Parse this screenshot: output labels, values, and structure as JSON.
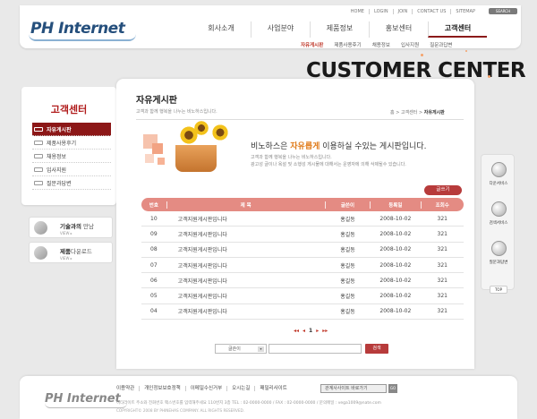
{
  "header": {
    "logo": "PH Internet",
    "util_links": [
      "HOME",
      "LOGIN",
      "JOIN",
      "CONTACT US",
      "SITEMAP"
    ],
    "search_label": "SEARCH",
    "gnb": [
      {
        "label": "회사소개",
        "active": false
      },
      {
        "label": "사업분야",
        "active": false
      },
      {
        "label": "제품정보",
        "active": false
      },
      {
        "label": "홍보센터",
        "active": false
      },
      {
        "label": "고객센터",
        "active": true
      }
    ],
    "sub_menu": [
      {
        "label": "자유게시판",
        "active": true
      },
      {
        "label": "제품사용후기",
        "active": false
      },
      {
        "label": "채용정보",
        "active": false
      },
      {
        "label": "입사지원",
        "active": false
      },
      {
        "label": "질문과답변",
        "active": false
      }
    ]
  },
  "banner": {
    "text": "CUSTOMER CENTER"
  },
  "sidebar": {
    "title": "고객센터",
    "items": [
      {
        "label": "자유게시판",
        "active": true
      },
      {
        "label": "제품사용후기",
        "active": false
      },
      {
        "label": "채용정보",
        "active": false
      },
      {
        "label": "입사지원",
        "active": false
      },
      {
        "label": "질문과답변",
        "active": false
      }
    ],
    "banners": [
      {
        "title_bold": "기술과의",
        "title_rest": " 만남",
        "more": "VIEW ▸"
      },
      {
        "title_bold": "제품",
        "title_rest": "다운로드",
        "more": "VIEW ▸"
      }
    ]
  },
  "quick_menu": {
    "items": [
      "다운서비스",
      "검색서비스",
      "질문과답변"
    ],
    "top": "TOP"
  },
  "page": {
    "title": "자유게시판",
    "subtitle": "고객과 함께 행복을 나누는 비노하스입니다.",
    "breadcrumb": [
      "홈",
      "고객센터",
      "자유게시판"
    ]
  },
  "intro": {
    "title_pre": "비노하스은 ",
    "title_em": "자유롭게",
    "title_post": " 이용하실 수있는 게시판입니다.",
    "desc1": "고객과 함께 행복을 나누는 비노하스입니다.",
    "desc2": "광고성 글이나 욕설 및 소행성 게시물에 대해서는 운영자에 의해 삭제될수 있습니다."
  },
  "board": {
    "write_label": "글쓰기",
    "columns": {
      "no": "번호",
      "title": "제 목",
      "writer": "글쓴이",
      "date": "등록일",
      "views": "조회수"
    },
    "rows": [
      {
        "no": "10",
        "title": "고객지원게시판입니다",
        "writer": "홍길동",
        "date": "2008-10-02",
        "views": "321"
      },
      {
        "no": "09",
        "title": "고객지원게시판입니다",
        "writer": "홍길동",
        "date": "2008-10-02",
        "views": "321"
      },
      {
        "no": "08",
        "title": "고객지원게시판입니다",
        "writer": "홍길동",
        "date": "2008-10-02",
        "views": "321"
      },
      {
        "no": "07",
        "title": "고객지원게시판입니다",
        "writer": "홍길동",
        "date": "2008-10-02",
        "views": "321"
      },
      {
        "no": "06",
        "title": "고객지원게시판입니다",
        "writer": "홍길동",
        "date": "2008-10-02",
        "views": "321"
      },
      {
        "no": "05",
        "title": "고객지원게시판입니다",
        "writer": "홍길동",
        "date": "2008-10-02",
        "views": "321"
      },
      {
        "no": "04",
        "title": "고객지원게시판입니다",
        "writer": "홍길동",
        "date": "2008-10-02",
        "views": "321"
      }
    ]
  },
  "pager": {
    "first": "◂◂",
    "prev": "◂",
    "current": "1",
    "next": "▸",
    "last": "▸▸"
  },
  "search": {
    "select_value": "글쓴이",
    "input_value": "",
    "button": "검색"
  },
  "footer": {
    "logo": "PH Internet",
    "links": [
      "이용약관",
      "개인정보보호정책",
      "이메일수신거부",
      "오시는길",
      "패밀리사이트"
    ],
    "family_select": "관계사사이트 바로가기",
    "go": "GO",
    "address": "히타라이트 주소와 전화번호 팩스번호를 입력해주세요 110번지 3층  TEL : 02-0000-0000 / FAX : 02-0000-0000 / 문의메일 : vega1009@nate.com",
    "copyright": "COPYRIGHT© 2008 BY PHINEHAS COMPANY. ALL RIGHTS RESERVED."
  },
  "colors": {
    "accent": "#8c1717",
    "table_head": "#e48b83",
    "highlight": "#e07b1a"
  }
}
